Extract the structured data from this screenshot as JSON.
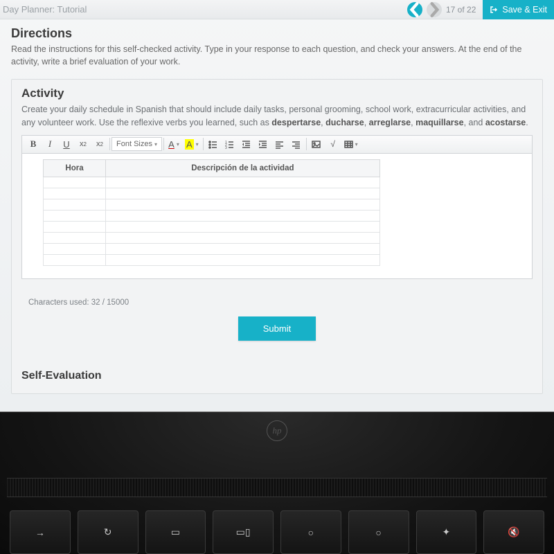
{
  "topbar": {
    "title": "Day Planner: Tutorial",
    "progress": "17 of 22",
    "save_exit": "Save & Exit"
  },
  "directions": {
    "heading": "Directions",
    "text": "Read the instructions for this self-checked activity. Type in your response to each question, and check your answers. At the end of the activity, write a brief evaluation of your work."
  },
  "activity": {
    "heading": "Activity",
    "text_pre": "Create your daily schedule in Spanish that should include daily tasks, personal grooming, school work, extracurricular activities, and any volunteer work. Use the reflexive verbs you learned, such as ",
    "verbs": [
      "despertarse",
      "ducharse",
      "arreglarse",
      "maquillarse",
      "acostarse"
    ],
    "text_joiner": ", ",
    "text_and": ", and ",
    "text_post": "."
  },
  "toolbar": {
    "font_sizes_label": "Font Sizes",
    "a_label": "A"
  },
  "table": {
    "col1": "Hora",
    "col2": "Descripción de la actividad",
    "blank_rows": 8
  },
  "char_counter": {
    "label": "Characters used: ",
    "used": 32,
    "limit": 15000
  },
  "submit_label": "Submit",
  "self_eval_heading": "Self-Evaluation",
  "laptop": {
    "brand": "hp",
    "keys": [
      "→",
      "↻",
      "▭",
      "▭▯",
      "○",
      "○",
      "✦",
      "🔇"
    ]
  }
}
